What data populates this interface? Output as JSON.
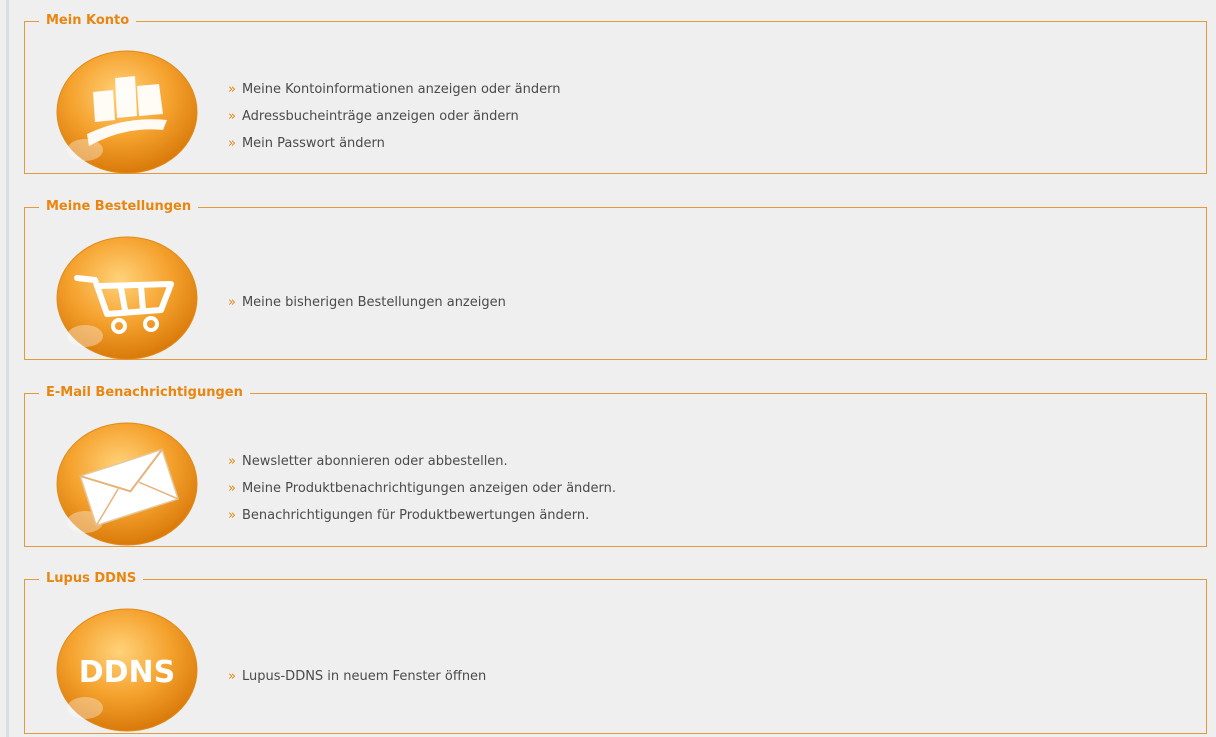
{
  "sections": [
    {
      "title": "Mein Konto",
      "icon": "account-cards-icon",
      "links": [
        "Meine Kontoinformationen anzeigen oder ändern",
        "Adressbucheinträge anzeigen oder ändern",
        "Mein Passwort ändern"
      ]
    },
    {
      "title": "Meine Bestellungen",
      "icon": "shopping-cart-icon",
      "links": [
        "Meine bisherigen Bestellungen anzeigen"
      ]
    },
    {
      "title": "E-Mail Benachrichtigungen",
      "icon": "envelope-icon",
      "links": [
        "Newsletter abonnieren oder abbestellen.",
        "Meine Produktbenachrichtigungen anzeigen oder ändern.",
        "Benachrichtigungen für Produktbewertungen ändern."
      ]
    },
    {
      "title": "Lupus DDNS",
      "icon": "ddns-icon",
      "icon_text": "DDNS",
      "links": [
        "Lupus-DDNS in neuem Fenster öffnen"
      ]
    }
  ],
  "bullet": "»",
  "colors": {
    "accent": "#e8860f",
    "border": "#e49a3c",
    "background": "#efefef",
    "link_text": "#4a4a4a"
  }
}
